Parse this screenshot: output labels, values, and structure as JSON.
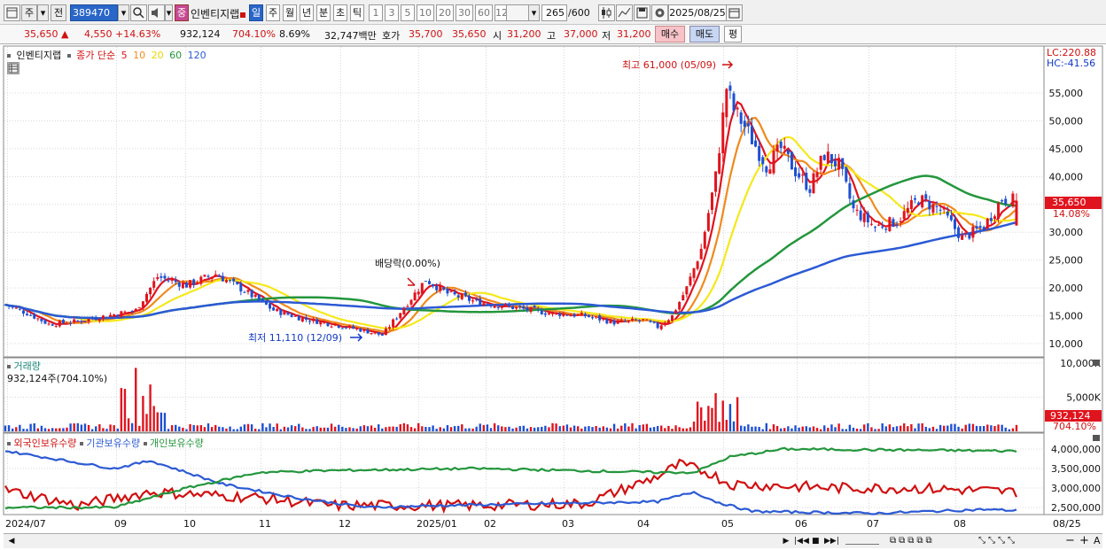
{
  "toolbar": {
    "period_label": "주",
    "prev_label": "전",
    "code": "389470",
    "stock_name": "인벤티지랩",
    "stock_tag": "중",
    "periods": [
      "일",
      "주",
      "월",
      "년",
      "분",
      "초",
      "틱"
    ],
    "active_period": "일",
    "intervals": [
      "1",
      "3",
      "5",
      "10",
      "20",
      "30",
      "60",
      "120"
    ],
    "count": "265",
    "count_total": "/600",
    "date": "2025/08/25"
  },
  "quote": {
    "price": "35,650",
    "change": "4,550",
    "change_pct": "+14.63%",
    "volume": "932,124",
    "volume_ratio": "704.10%",
    "turnover_pct": "8.69%",
    "amount": "32,747백만",
    "ask_label": "호가",
    "ask1": "35,700",
    "ask2": "35,650",
    "open_label": "시",
    "open": "31,200",
    "high_label": "고",
    "high": "37,000",
    "low_label": "저",
    "low": "31,200",
    "buy_label": "매수",
    "sell_label": "매도",
    "eval_label": "평"
  },
  "price_pane": {
    "legend_name": "인벤티지랩",
    "legend_ma_label": "종가 단순",
    "ma_periods": [
      "5",
      "10",
      "20",
      "60",
      "120"
    ],
    "ma_colors": [
      "#e0141e",
      "#f08a1c",
      "#f5e81a",
      "#23963c",
      "#2c5ad4"
    ],
    "lc_label": "LC:220.88",
    "hc_label": "HC:-41.56",
    "y_ticks": [
      "55,000",
      "50,000",
      "45,000",
      "40,000",
      "35,000",
      "30,000",
      "25,000",
      "20,000",
      "15,000",
      "10,000"
    ],
    "last_price_tag": "35,650",
    "last_pct_tag": "14.08%",
    "annotations": {
      "high": "최고 61,000 (05/09)",
      "low": "최저 11,110 (12/09)",
      "dividend": "배당락(0.00%)"
    }
  },
  "volume_pane": {
    "title": "거래량",
    "value_text": "932,124주(704.10%)",
    "y_ticks": [
      "10,000K",
      "5,000K"
    ],
    "last_tag": "932,124",
    "last_pct_tag": "704.10%"
  },
  "holdings_pane": {
    "series": [
      "외국인보유수량",
      "기관보유수량",
      "개인보유수량"
    ],
    "series_colors": [
      "#d01010",
      "#2c5ad4",
      "#23963c"
    ],
    "y_ticks": [
      "4,000,000",
      "3,500,000",
      "3,000,000",
      "2,500,000"
    ]
  },
  "x_axis": {
    "labels": [
      "2024/07",
      "09",
      "10",
      "11",
      "12",
      "2025/01",
      "02",
      "03",
      "04",
      "05",
      "06",
      "07",
      "08"
    ],
    "right_label": "08/25"
  },
  "colors": {
    "up": "#e0141e",
    "down": "#1e50d2",
    "selection": "#2a66c8"
  }
}
